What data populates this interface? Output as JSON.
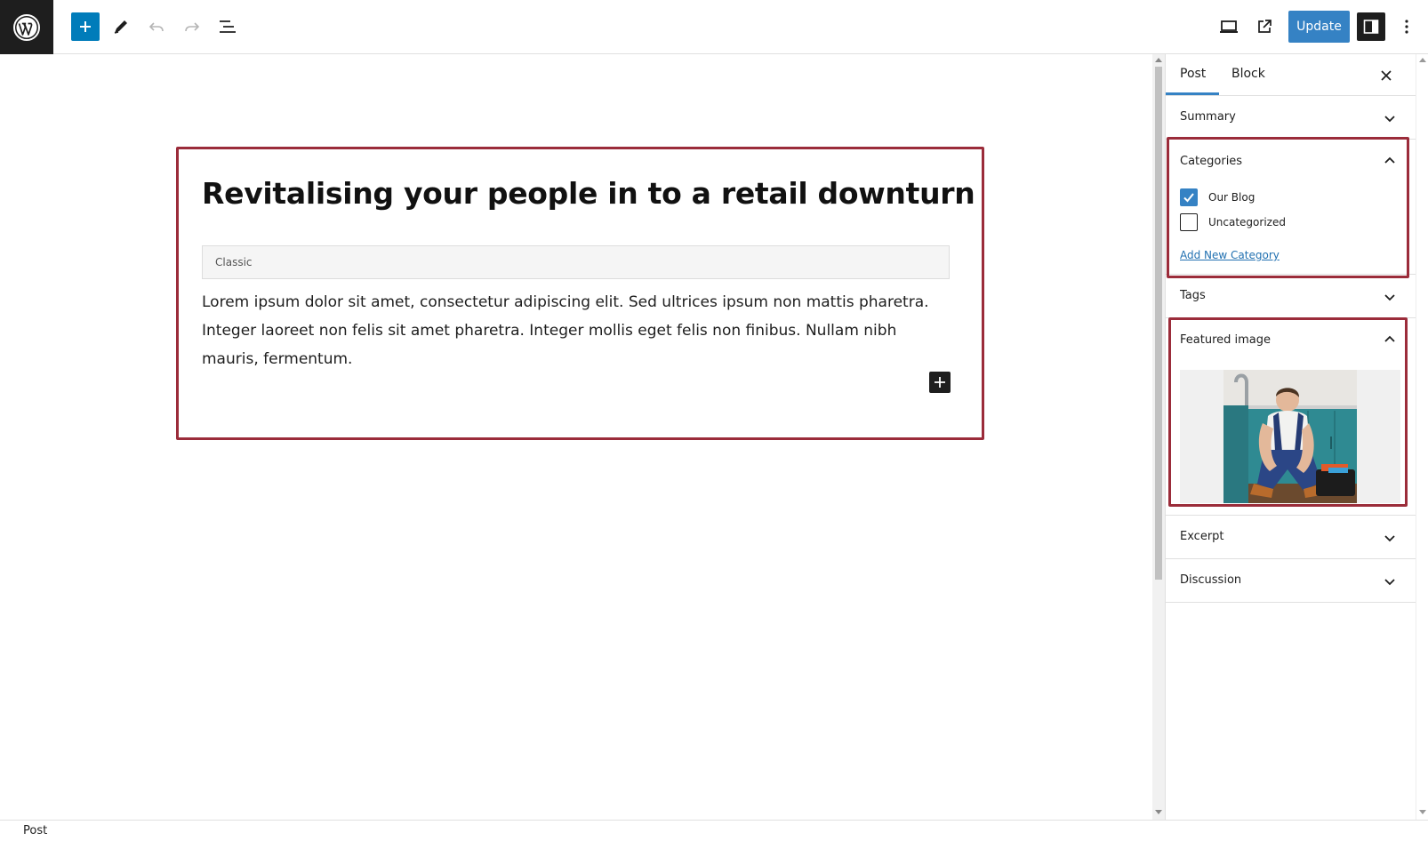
{
  "toolbar": {
    "update_label": "Update"
  },
  "editor": {
    "title": "Revitalising your people in to a retail downturn",
    "classic_label": "Classic",
    "body": "Lorem ipsum dolor sit amet, consectetur adipiscing elit. Sed ultrices ipsum non mattis pharetra. Integer laoreet non felis sit amet pharetra. Integer mollis eget felis non finibus. Nullam nibh mauris, fermentum."
  },
  "sidebar": {
    "tabs": [
      {
        "label": "Post",
        "active": true
      },
      {
        "label": "Block",
        "active": false
      }
    ],
    "panels": {
      "summary": {
        "label": "Summary",
        "expanded": false
      },
      "categories": {
        "label": "Categories",
        "expanded": true,
        "items": [
          {
            "label": "Our Blog",
            "checked": true
          },
          {
            "label": "Uncategorized",
            "checked": false
          }
        ],
        "add_new_label": "Add New Category"
      },
      "tags": {
        "label": "Tags",
        "expanded": false
      },
      "featured_image": {
        "label": "Featured image",
        "expanded": true
      },
      "excerpt": {
        "label": "Excerpt",
        "expanded": false
      },
      "discussion": {
        "label": "Discussion",
        "expanded": false
      }
    }
  },
  "status_bar": {
    "breadcrumb": "Post"
  },
  "colors": {
    "accent": "#3582c4",
    "highlight": "#9b2c3a",
    "dark": "#1e1e1e"
  }
}
